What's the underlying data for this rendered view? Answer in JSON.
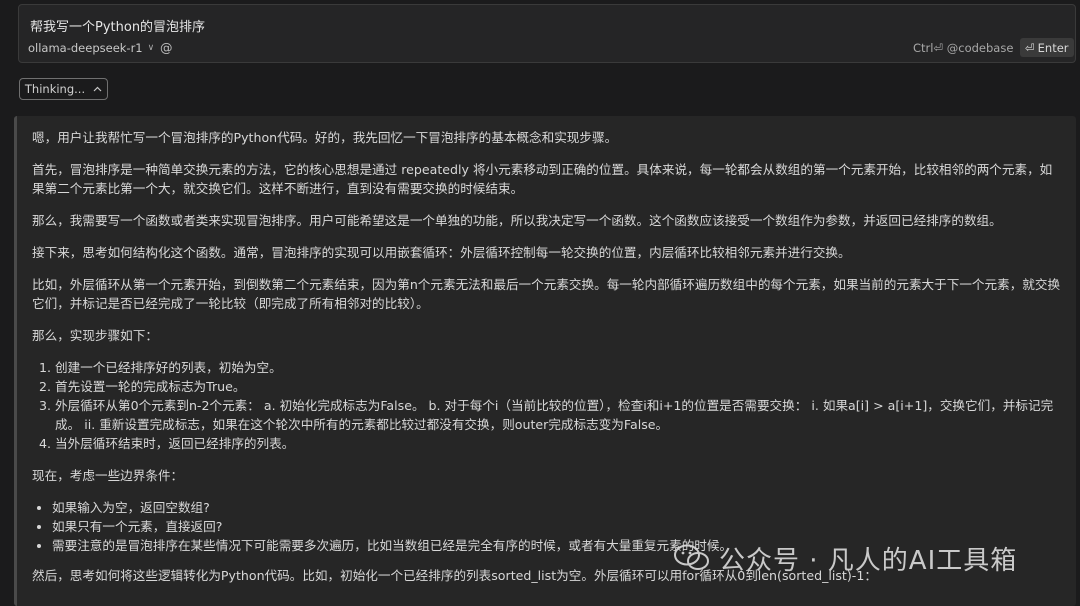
{
  "prompt": {
    "text": "帮我写一个Python的冒泡排序",
    "model": "ollama-deepseek-r1",
    "mention_symbol": "@",
    "shortcut_hint": "Ctrl⏎ @codebase",
    "enter_icon": "⏎",
    "enter_label": "Enter"
  },
  "thinking": {
    "toggle_label": "Thinking...",
    "paragraphs": [
      "嗯，用户让我帮忙写一个冒泡排序的Python代码。好的，我先回忆一下冒泡排序的基本概念和实现步骤。",
      "首先，冒泡排序是一种简单交换元素的方法，它的核心思想是通过 repeatedly 将小元素移动到正确的位置。具体来说，每一轮都会从数组的第一个元素开始，比较相邻的两个元素，如果第二个元素比第一个大，就交换它们。这样不断进行，直到没有需要交换的时候结束。",
      "那么，我需要写一个函数或者类来实现冒泡排序。用户可能希望这是一个单独的功能，所以我决定写一个函数。这个函数应该接受一个数组作为参数，并返回已经排序的数组。",
      "接下来，思考如何结构化这个函数。通常，冒泡排序的实现可以用嵌套循环：外层循环控制每一轮交换的位置，内层循环比较相邻元素并进行交换。",
      "比如，外层循环从第一个元素开始，到倒数第二个元素结束，因为第n个元素无法和最后一个元素交换。每一轮内部循环遍历数组中的每个元素，如果当前的元素大于下一个元素，就交换它们，并标记是否已经完成了一轮比较（即完成了所有相邻对的比较）。",
      "那么，实现步骤如下："
    ],
    "steps": [
      "创建一个已经排序好的列表，初始为空。",
      "首先设置一轮的完成标志为True。",
      "外层循环从第0个元素到n-2个元素： a. 初始化完成标志为False。 b. 对于每个i（当前比较的位置），检查i和i+1的位置是否需要交换： i. 如果a[i] > a[i+1]，交换它们，并标记完成。 ii. 重新设置完成标志，如果在这个轮次中所有的元素都比较过都没有交换，则outer完成标志变为False。",
      "当外层循环结束时，返回已经排序的列表。"
    ],
    "edge_intro": "现在，考虑一些边界条件：",
    "edge_cases": [
      "如果输入为空，返回空数组?",
      "如果只有一个元素，直接返回?",
      "需要注意的是冒泡排序在某些情况下可能需要多次遍历，比如当数组已经是完全有序的时候，或者有大量重复元素的时候。"
    ],
    "closing": "然后，思考如何将这些逻辑转化为Python代码。比如，初始化一个已经排序的列表sorted_list为空。外层循环可以用for循环从0到len(sorted_list)-1："
  },
  "watermark": {
    "text": "公众号 · 凡人的AI工具箱",
    "icon": "wechat-icon"
  }
}
